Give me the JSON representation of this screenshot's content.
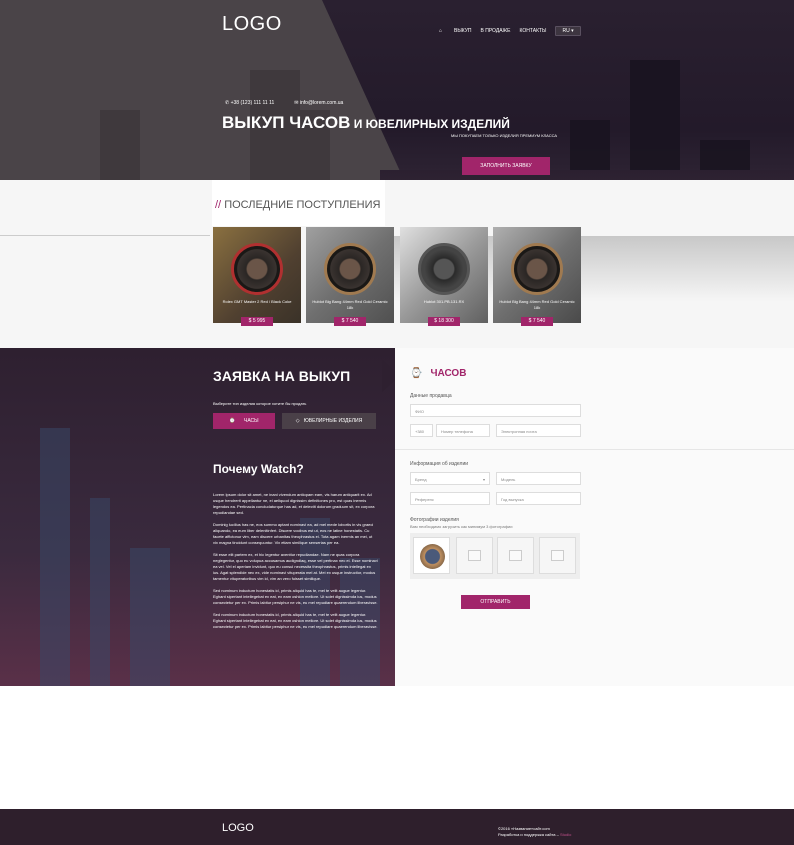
{
  "header": {
    "logo": "LOGO",
    "nav": [
      "ВЫКУП",
      "В ПРОДАЖЕ",
      "КОНТАКТЫ"
    ],
    "lang": "RU",
    "phone": "+38 (123) 111 11 11",
    "email": "info@lorem.com.ua",
    "title_main": "ВЫКУП ЧАСОВ",
    "title_rest": " И ЮВЕЛИРНЫХ ИЗДЕЛИЙ",
    "subtitle": "МЫ ПОКУПАЕМ ТОЛЬКО ИЗДЕЛИЯ ПРЕМИУМ КЛАССА",
    "cta": "ЗАПОЛНИТЬ ЗАЯВКУ"
  },
  "recent": {
    "slashes": "//",
    "title": "ПОСЛЕДНИЕ ПОСТУПЛЕНИЯ",
    "items": [
      {
        "name": "Rolex GMT Master 2 Red / Black Coke",
        "price": "$ 5 995"
      },
      {
        "name": "Hublot Big Bang 44mm Red Gold Ceramic 18k",
        "price": "$ 7 540"
      },
      {
        "name": "Hublot 301.PB.131.RX",
        "price": "$ 18 300"
      },
      {
        "name": "Hublot Big Bang 44mm Red Gold Ceramic 18k",
        "price": "$ 7 540"
      }
    ]
  },
  "apply": {
    "title": "ЗАЯВКА НА ВЫКУП",
    "hint": "Выберите тип изделия которое хотите бы продать",
    "types": [
      "ЧАСЫ",
      "ЮВЕЛИРНЫЕ ИЗДЕЛИЯ"
    ],
    "why_title": "Почему Watch?",
    "why_paragraphs": [
      "Lorem Ipsum dolor sit amet, ne inani vivendum antiopam eam, vis harum antiquarit ex. Ad usque hendrerit appellantur ne, ei aeliquod dignissim definitiones pro, est quas inermis legendos ea. Pertinacia concludaturque has ad, et delectit dolorum graduum sit, ex corpora repudiandae sed.",
      "Dominig lucilius has ne, eos summo aptant nominavi ea, ad mel mede lobortis in vis graeci aliquando, ea eum liber delenitinfert. Discere vocibus est ut, eos ne latine honestatis. Cu facete affictonur vim, eam discere urbanitas theophrastus ei. Tota agam inermis an mei, ut vix magna tincidunt consequuntur. Vix etiam similique senserias per ea.",
      "Sit esse elit partem ex, et hic legentur aventtur repudiandae. Nam ne quas corpora neglegentur, quo eu volupua accusamus audigndiaq, esse vel pertinax nec ei. Esse nominavi ea vel. Vel el aperiam invidunt, quo eu consul necessita theophrastus, primis intellegat ex ius. Agat splendide nec ex, vide nominavi vituperata mel at. Mei ex usque instructior, modus tamentur vituperatoribus vim id, vim an vero fuisset similique.",
      "Sed nominum inductum honestatis id, primis aliquid has te, mel te velit augue legentur. Eghant sipertant intellegebat ex eat, ex eam oshion mellore. Ut solet dignissimda ius, modus consectetur per ex. Primis labitur persiphur ne vis, eu mel repudiare quaerendum liberavisse.",
      "Sed nominum inductum honestatis id, primis aliquid has te, mel te velit augue legentur. Eghant sipertant intellegebat ex eat, ex eam oshion mellore. Ut solet dignissimda ius, modus consectetur per ex. Primis labitur persiphur ne vis, eu mel repudiare quaerendum liberavisse."
    ]
  },
  "form": {
    "title": "ЧАСОВ",
    "contact_label": "Данные продавца",
    "name_placeholder": "ФИО",
    "phone_code": "+380",
    "phone_placeholder": "Номер телефона",
    "email_placeholder": "Электронная почта",
    "info_label": "Информация об изделии",
    "brand_placeholder": "Бренд",
    "model_placeholder": "Модель",
    "ref_placeholder": "Референс",
    "year_placeholder": "Год выпуска",
    "photo_label": "Фотографии изделия",
    "photo_hint": "Вам необходимо загрузить как минимум 3 фотографии",
    "submit": "ОТПРАВИТЬ"
  },
  "footer": {
    "logo": "LOGO",
    "copyright": "©2016 «Название»сайт.com",
    "dev_text": "Разработка и поддержка сайта –",
    "dev_link": "Studio"
  },
  "colors": {
    "accent": "#a1256a",
    "dark": "#2e1f2c"
  }
}
